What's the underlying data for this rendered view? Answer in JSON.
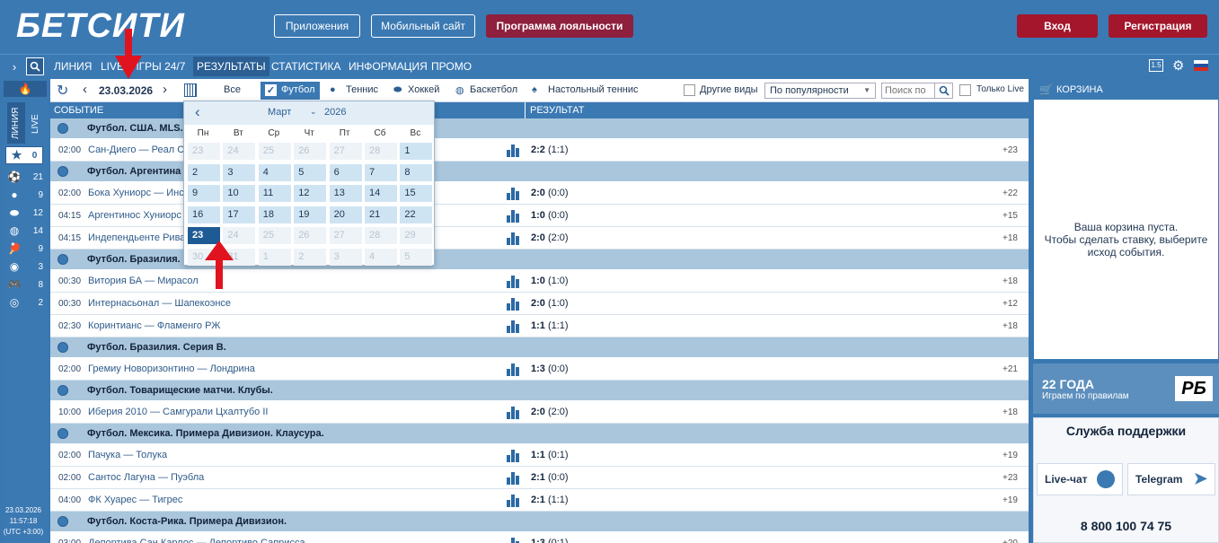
{
  "header": {
    "logo": "БЕТСИТИ",
    "apps": "Приложения",
    "mobile": "Мобильный сайт",
    "loyalty": "Программа лояльности",
    "login": "Вход",
    "register": "Регистрация"
  },
  "nav": {
    "items": [
      "ЛИНИЯ",
      "LIVE",
      "ИГРЫ 24/7",
      "РЕЗУЛЬТАТЫ",
      "СТАТИСТИКА",
      "ИНФОРМАЦИЯ",
      "ПРОМО"
    ],
    "active": "РЕЗУЛЬТАТЫ",
    "badge": "1.5"
  },
  "sidebar": {
    "tab_line": "ЛИНИЯ",
    "tab_live": "LIVE",
    "fav_count": "0",
    "counts": [
      "21",
      "9",
      "12",
      "14",
      "9",
      "3",
      "8",
      "2"
    ],
    "date": "23.03.2026",
    "time": "11:57:18",
    "tz": "(UTC +3:00)"
  },
  "toolbar": {
    "date": "23.03.2026",
    "all": "Все",
    "football": "Футбол",
    "tennis": "Теннис",
    "hockey": "Хоккей",
    "basketball": "Баскетбол",
    "tabletennis": "Настольный теннис",
    "other": "Другие виды",
    "sort": "По популярности",
    "search_placeholder": "Поиск по",
    "live_only": "Только Live"
  },
  "table": {
    "col_event": "СОБЫТИЕ",
    "col_result": "РЕЗУЛЬТАТ",
    "groups": [
      {
        "title": "Футбол. США. MLS.",
        "events": [
          {
            "time": "02:00",
            "name": "Сан-Диего — Реал Со",
            "score": "2:2",
            "half": "(1:1)",
            "plus": "+23"
          }
        ]
      },
      {
        "title": "Футбол. Аргентина",
        "events": [
          {
            "time": "02:00",
            "name": "Бока Хуниорс — Инст",
            "score": "2:0",
            "half": "(0:0)",
            "plus": "+22"
          },
          {
            "time": "04:15",
            "name": "Аргентинос Хуниорс",
            "score": "1:0",
            "half": "(0:0)",
            "plus": "+15"
          },
          {
            "time": "04:15",
            "name": "Индепендьенте Рива",
            "score": "2:0",
            "half": "(2:0)",
            "plus": "+18"
          }
        ]
      },
      {
        "title": "Футбол. Бразилия.",
        "events": [
          {
            "time": "00:30",
            "name": "Витория БА — Мирасол",
            "score": "1:0",
            "half": "(1:0)",
            "plus": "+18"
          },
          {
            "time": "00:30",
            "name": "Интернасьонал — Шапекоэнсе",
            "score": "2:0",
            "half": "(1:0)",
            "plus": "+12"
          },
          {
            "time": "02:30",
            "name": "Коринтианс — Фламенго РЖ",
            "score": "1:1",
            "half": "(1:1)",
            "plus": "+18"
          }
        ]
      },
      {
        "title": "Футбол. Бразилия. Серия B.",
        "events": [
          {
            "time": "02:00",
            "name": "Гремиу Новоризонтино — Лондрина",
            "score": "1:3",
            "half": "(0:0)",
            "plus": "+21"
          }
        ]
      },
      {
        "title": "Футбол. Товарищеские матчи. Клубы.",
        "events": [
          {
            "time": "10:00",
            "name": "Иберия 2010 — Самгурали Цхалтубо II",
            "score": "2:0",
            "half": "(2:0)",
            "plus": "+18"
          }
        ]
      },
      {
        "title": "Футбол. Мексика. Примера Дивизион. Клаусура.",
        "events": [
          {
            "time": "02:00",
            "name": "Пачука — Толука",
            "score": "1:1",
            "half": "(0:1)",
            "plus": "+19"
          },
          {
            "time": "02:00",
            "name": "Сантос Лагуна — Пуэбла",
            "score": "2:1",
            "half": "(0:0)",
            "plus": "+23"
          },
          {
            "time": "04:00",
            "name": "ФК Хуарес — Тигрес",
            "score": "2:1",
            "half": "(1:1)",
            "plus": "+19"
          }
        ]
      },
      {
        "title": "Футбол. Коста-Рика. Примера Дивизион.",
        "events": [
          {
            "time": "03:00",
            "name": "Депортива Сан Карлос — Депортиво Саприсса",
            "score": "1:3",
            "half": "(0:1)",
            "plus": "+20"
          }
        ]
      }
    ]
  },
  "calendar": {
    "month": "Март",
    "year": "2026",
    "weekdays": [
      "Пн",
      "Вт",
      "Ср",
      "Чт",
      "Пт",
      "Сб",
      "Вс"
    ],
    "weeks": [
      [
        "23",
        "24",
        "25",
        "26",
        "27",
        "28",
        "1"
      ],
      [
        "2",
        "3",
        "4",
        "5",
        "6",
        "7",
        "8"
      ],
      [
        "9",
        "10",
        "11",
        "12",
        "13",
        "14",
        "15"
      ],
      [
        "16",
        "17",
        "18",
        "19",
        "20",
        "21",
        "22"
      ],
      [
        "23",
        "24",
        "25",
        "26",
        "27",
        "28",
        "29"
      ],
      [
        "30",
        "31",
        "1",
        "2",
        "3",
        "4",
        "5"
      ]
    ],
    "states": [
      [
        "dim",
        "dim",
        "dim",
        "dim",
        "dim",
        "dim",
        "on"
      ],
      [
        "on",
        "on",
        "on",
        "on",
        "on",
        "on",
        "on"
      ],
      [
        "on",
        "on",
        "on",
        "on",
        "on",
        "on",
        "on"
      ],
      [
        "on",
        "on",
        "on",
        "on",
        "on",
        "on",
        "on"
      ],
      [
        "sel",
        "dim",
        "dim",
        "dim",
        "dim",
        "dim",
        "dim"
      ],
      [
        "dim",
        "dim",
        "dim",
        "dim",
        "dim",
        "dim",
        "dim"
      ]
    ]
  },
  "cart": {
    "title": "КОРЗИНА",
    "empty1": "Ваша корзина пуста.",
    "empty2": "Чтобы сделать ставку, выберите",
    "empty3": "исход события."
  },
  "promo": {
    "title": "22 ГОДА",
    "subtitle": "Играем по правилам",
    "logo": "РБ"
  },
  "support": {
    "title": "Служба поддержки",
    "live_chat": "Live-чат",
    "telegram": "Telegram",
    "phone": "8 800 100 74 75"
  },
  "colors": {
    "brand": "#3b79b3",
    "loyalty": "#8e1f3d",
    "login": "#a3162c",
    "selected_day": "#1e5b95",
    "arrow": "#e0141e"
  }
}
